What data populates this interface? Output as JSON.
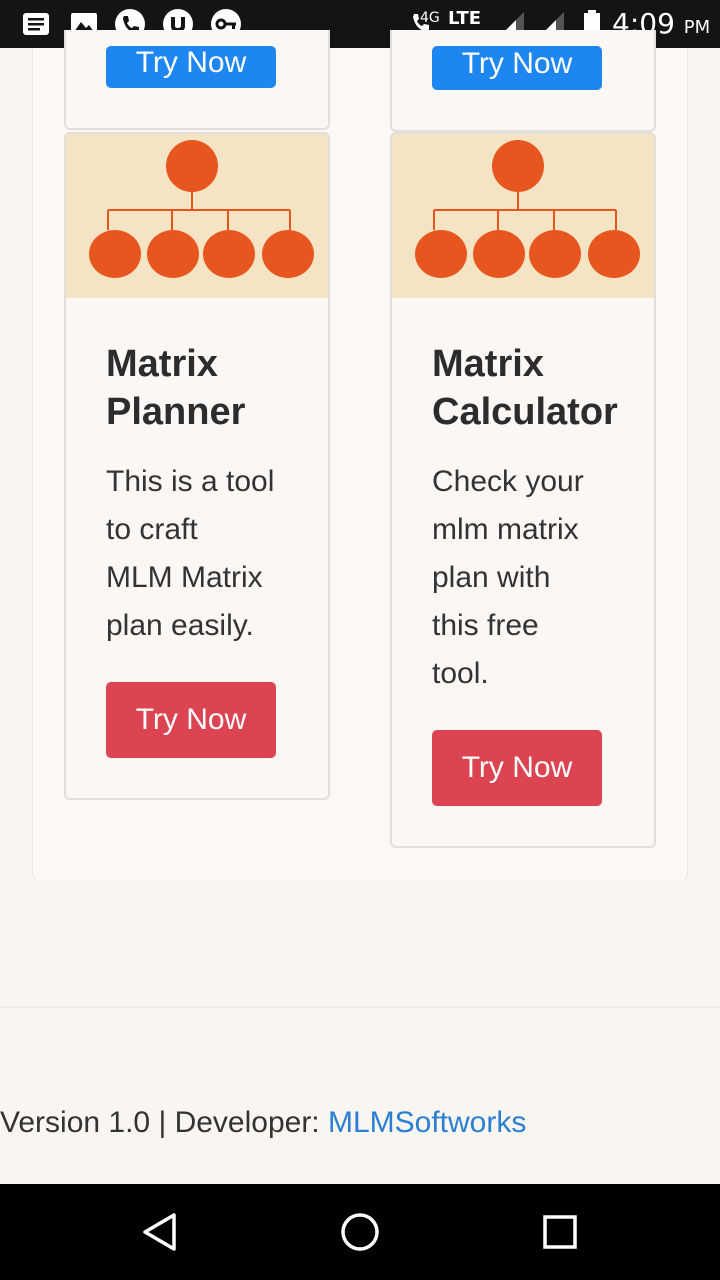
{
  "status_bar": {
    "network": "4G",
    "lte": "LTE",
    "time": "4:09",
    "ampm": "PM"
  },
  "top_cards": [
    {
      "button_label": "Try Now"
    },
    {
      "button_label": "Try Now"
    }
  ],
  "cards": [
    {
      "title_line1": "Matrix",
      "title_line2": "Planner",
      "desc_lines": [
        "This is a tool",
        "to craft",
        "MLM Matrix",
        "plan easily."
      ],
      "button_label": "Try Now"
    },
    {
      "title_line1": "Matrix",
      "title_line2": "Calculator",
      "desc_lines": [
        "Check your",
        "mlm matrix",
        "plan with",
        "this free",
        "tool."
      ],
      "button_label": "Try Now"
    }
  ],
  "footer": {
    "version_text": "Version 1.0 | Developer: ",
    "developer_link": "MLMSoftworks"
  },
  "colors": {
    "accent_blue": "#1d86f0",
    "accent_red": "#dc4452",
    "link": "#2a7fd4",
    "node_orange": "#e8561f",
    "image_bg": "#f4e4c3"
  },
  "icons": {
    "status_left": [
      "notification-list-icon",
      "gallery-icon",
      "phone-icon",
      "utorrent-icon",
      "vpn-key-icon"
    ],
    "status_right": [
      "wifi-call-icon",
      "signal-icon",
      "signal-icon",
      "battery-icon"
    ],
    "nav": [
      "back-icon",
      "home-icon",
      "recents-icon"
    ]
  }
}
